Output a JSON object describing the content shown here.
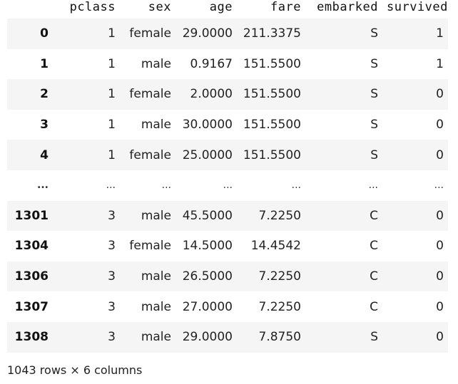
{
  "table": {
    "index_header": "",
    "columns": [
      "pclass",
      "sex",
      "age",
      "fare",
      "embarked",
      "survived"
    ],
    "rows": [
      {
        "index": "0",
        "cells": [
          "1",
          "female",
          "29.0000",
          "211.3375",
          "S",
          "1"
        ]
      },
      {
        "index": "1",
        "cells": [
          "1",
          "male",
          "0.9167",
          "151.5500",
          "S",
          "1"
        ]
      },
      {
        "index": "2",
        "cells": [
          "1",
          "female",
          "2.0000",
          "151.5500",
          "S",
          "0"
        ]
      },
      {
        "index": "3",
        "cells": [
          "1",
          "male",
          "30.0000",
          "151.5500",
          "S",
          "0"
        ]
      },
      {
        "index": "4",
        "cells": [
          "1",
          "female",
          "25.0000",
          "151.5500",
          "S",
          "0"
        ]
      },
      {
        "index": "...",
        "cells": [
          "...",
          "...",
          "...",
          "...",
          "...",
          "..."
        ]
      },
      {
        "index": "1301",
        "cells": [
          "3",
          "male",
          "45.5000",
          "7.2250",
          "C",
          "0"
        ]
      },
      {
        "index": "1304",
        "cells": [
          "3",
          "female",
          "14.5000",
          "14.4542",
          "C",
          "0"
        ]
      },
      {
        "index": "1306",
        "cells": [
          "3",
          "male",
          "26.5000",
          "7.2250",
          "C",
          "0"
        ]
      },
      {
        "index": "1307",
        "cells": [
          "3",
          "male",
          "27.0000",
          "7.2250",
          "C",
          "0"
        ]
      },
      {
        "index": "1308",
        "cells": [
          "3",
          "male",
          "29.0000",
          "7.8750",
          "S",
          "0"
        ]
      }
    ]
  },
  "footer": {
    "shape_text": "1043 rows × 6 columns"
  }
}
